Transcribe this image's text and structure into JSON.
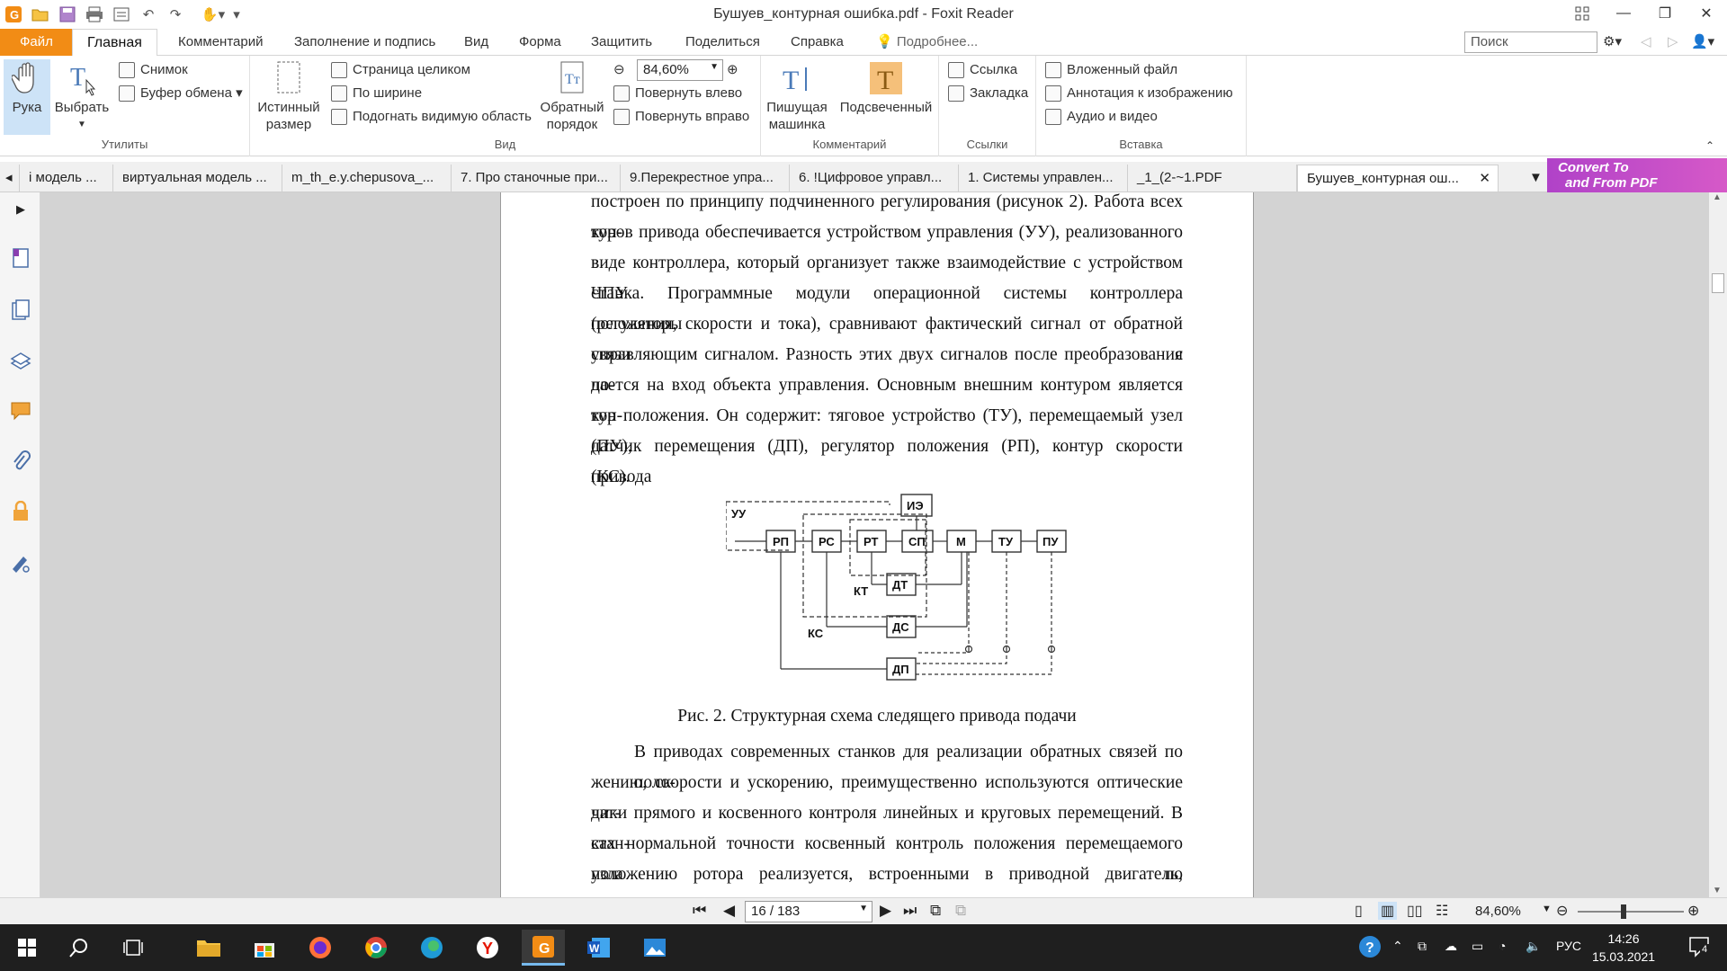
{
  "window": {
    "title": "Бушуев_контурная ошибка.pdf - Foxit Reader"
  },
  "menu": {
    "file": "Файл",
    "tabs": [
      "Главная",
      "Комментарий",
      "Заполнение и подпись",
      "Вид",
      "Форма",
      "Защитить",
      "Поделиться",
      "Справка"
    ],
    "tell_me": "Подробнее...",
    "search_placeholder": "Поиск"
  },
  "ribbon": {
    "utilities": {
      "label": "Утилиты",
      "hand": "Рука",
      "select": "Выбрать",
      "snapshot": "Снимок",
      "clipboard": "Буфер обмена"
    },
    "view": {
      "label": "Вид",
      "actual_size_line1": "Истинный",
      "actual_size_line2": "размер",
      "fit_page": "Страница целиком",
      "fit_width": "По ширине",
      "fit_visible": "Подогнать видимую область",
      "reverse_line1": "Обратный",
      "reverse_line2": "порядок",
      "zoom": "84,60%",
      "rotate_left": "Повернуть влево",
      "rotate_right": "Повернуть вправо"
    },
    "comment": {
      "label": "Комментарий",
      "typewriter_line1": "Пишущая",
      "typewriter_line2": "машинка",
      "highlight": "Подсвеченный"
    },
    "links": {
      "label": "Ссылки",
      "link": "Ссылка",
      "bookmark": "Закладка"
    },
    "insert": {
      "label": "Вставка",
      "attachment": "Вложенный файл",
      "image_annotation": "Аннотация к изображению",
      "audio_video": "Аудио и видео"
    }
  },
  "doc_tabs": [
    "і модель ...",
    "виртуальная модель ...",
    "m_th_e.y.chepusova_...",
    "7. Про станочные при...",
    "9.Перекрестное упра...",
    "6. !Цифровое управл...",
    "1. Системы управлен...",
    "_1_(2-~1.PDF",
    "Бушуев_контурная ош..."
  ],
  "promo": {
    "line1": "Convert To",
    "line2": "and From PDF"
  },
  "document": {
    "paragraph1": [
      "построен по принципу подчиненного регулирования (рисунок 2). Работа всех кон-",
      "туров привода обеспечивается устройством управления (УУ), реализованного в",
      "виде контроллера, который организует также взаимодействие с устройством ЧПУ",
      "станка. Программные модули операционной системы контроллера (регуляторы",
      "положения, скорости и тока), сравнивают фактический сигнал от обратной связи с",
      "управляющим сигналом. Разность этих двух сигналов после преобразования по-",
      "дается на вход объекта управления. Основным внешним контуром является кон-",
      "тур положения. Он содержит: тяговое устройство (ТУ), перемещаемый узел (ПУ),",
      "датчик перемещения (ДП), регулятор положения (РП), контур скорости привода",
      "(КС)."
    ],
    "diagram": {
      "uu": "УУ",
      "ie": "ИЭ",
      "rp": "РП",
      "rs": "РС",
      "rt": "РТ",
      "sp": "СП",
      "m": "М",
      "tu": "ТУ",
      "pu": "ПУ",
      "dt": "ДТ",
      "kt": "КТ",
      "ds": "ДС",
      "ks": "КС",
      "dp": "ДП"
    },
    "caption": "Рис. 2. Структурная схема следящего привода подачи",
    "paragraph2": [
      "В приводах современных станков для реализации обратных связей по поло-",
      "жению, скорости и ускорению, преимущественно используются оптические дат-",
      "чики прямого и косвенного контроля линейных и круговых перемещений. В стан-",
      "ках нормальной точности косвенный контроль положения перемещаемого узла по",
      "положению ротора реализуется, встроенными в приводной двигатель, датчиками"
    ]
  },
  "statusbar": {
    "page": "16 / 183",
    "zoom": "84,60%"
  },
  "taskbar": {
    "language": "РУС",
    "time": "14:26",
    "date": "15.03.2021",
    "notifications": "4"
  }
}
